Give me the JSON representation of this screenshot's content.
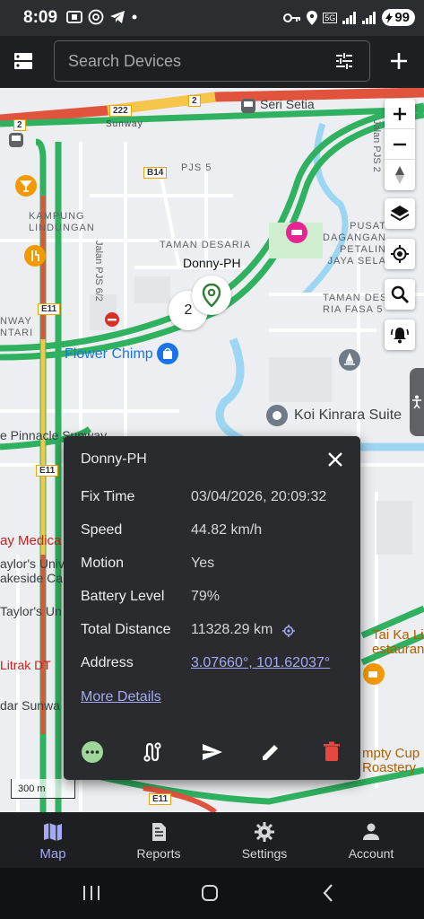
{
  "status_bar": {
    "time": "8:09",
    "battery": "99",
    "network_label": "5G"
  },
  "app_bar": {
    "search_placeholder": "Search Devices",
    "list_icon": "device-list-icon",
    "filter_icon": "tune-icon",
    "add_icon": "plus-icon"
  },
  "map": {
    "labels": {
      "seri_setia": "Seri Setia",
      "sunway": "Sunway",
      "pjs5": "PJS 5",
      "kampung_lindungan": "KAMPUNG\nLINDUNGAN",
      "jalan_pjs62": "Jalan PJS 6/2",
      "taman_desaria": "TAMAN DESARIA",
      "pusat_dagangan": "PUSAT\nDAGANGAN\nPETALIN\nJAYA SELA",
      "taman_desaria_fasa": "TAMAN DES\nRIA FASA 5",
      "flower_chimp": "Flower Chimp",
      "koi_kinrara": "Koi Kinrara Suite",
      "pinnacle_sunway": "e Pinnacle Sunway",
      "nway_ntari": "NWAY\nNTARI",
      "jalan_pjs2": "Jalan PJS 2",
      "ay_medica": "ay Medica",
      "taylors_univ": "aylor's Univ\nakeside Ca",
      "taylors_u": "Taylor's Un",
      "litrak": "Litrak DT",
      "dar_sunwa": "dar Sunwa",
      "tai_ka_li": "Tai Ka Li\nestaurant",
      "empty_cup": "mpty Cup\nRoastery"
    },
    "road_shields": {
      "r2a": "2",
      "r2b": "2",
      "r222": "222",
      "b14": "B14",
      "e11a": "E11",
      "e11b": "E11",
      "e11c": "E11"
    },
    "cluster_count": "2",
    "device_marker_label": "Donny-PH",
    "scale": "300 m",
    "controls": {
      "zoom_in": "plus-icon",
      "zoom_out": "minus-icon",
      "compass": "compass-icon",
      "layers": "layers-icon",
      "locate": "my-location-icon",
      "search": "search-icon",
      "alerts": "bell-ring-icon"
    }
  },
  "popup": {
    "title": "Donny-PH",
    "rows": [
      {
        "label": "Fix Time",
        "value": "03/04/2026, 20:09:32"
      },
      {
        "label": "Speed",
        "value": "44.82 km/h"
      },
      {
        "label": "Motion",
        "value": "Yes"
      },
      {
        "label": "Battery Level",
        "value": "79%"
      },
      {
        "label": "Total Distance",
        "value": "11328.29 km"
      },
      {
        "label": "Address",
        "value": "3.07660°, 101.62037°"
      }
    ],
    "more_details": "More Details",
    "colors": {
      "accent": "#a4a9f2",
      "more_button": "#9ed79a",
      "delete": "#e5483e"
    }
  },
  "bottom_nav": {
    "items": [
      {
        "label": "Map",
        "icon": "map-icon",
        "active": true
      },
      {
        "label": "Reports",
        "icon": "report-icon",
        "active": false
      },
      {
        "label": "Settings",
        "icon": "gear-icon",
        "active": false
      },
      {
        "label": "Account",
        "icon": "person-icon",
        "active": false
      }
    ]
  }
}
